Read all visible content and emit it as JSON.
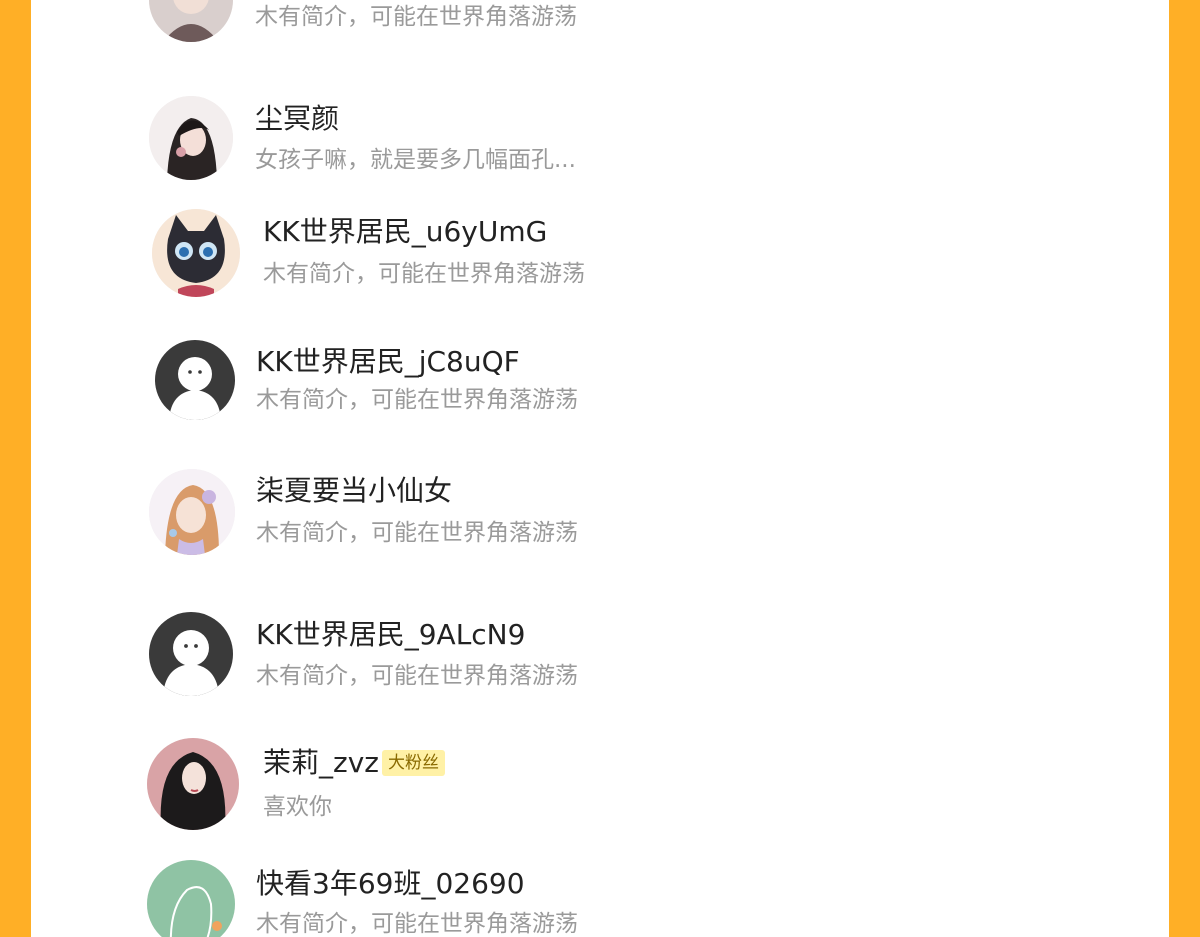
{
  "users": [
    {
      "name": "",
      "bio": "木有简介，可能在世界角落游荡",
      "avatar": "girl-portrait-avatar"
    },
    {
      "name": "尘冥颜",
      "bio": "女孩子嘛，就是要多几幅面孔...",
      "avatar": "girl-portrait-avatar"
    },
    {
      "name": "KK世界居民_u6yUmG",
      "bio": "木有简介，可能在世界角落游荡",
      "avatar": "black-cat-avatar"
    },
    {
      "name": "KK世界居民_jC8uQF",
      "bio": "木有简介，可能在世界角落游荡",
      "avatar": "default-ghost-avatar"
    },
    {
      "name": "柒夏要当小仙女",
      "bio": "木有简介，可能在世界角落游荡",
      "avatar": "anime-girl-avatar"
    },
    {
      "name": "KK世界居民_9ALcN9",
      "bio": "木有简介，可能在世界角落游荡",
      "avatar": "default-ghost-avatar"
    },
    {
      "name": "茉莉_zvz",
      "badge": "大粉丝",
      "bio": "喜欢你",
      "avatar": "dark-hair-girl-avatar"
    },
    {
      "name": "快看3年69班_02690",
      "bio": "木有简介，可能在世界角落游荡",
      "avatar": "green-silhouette-avatar"
    }
  ],
  "colors": {
    "frame_background": "#FFAF26",
    "badge_background": "#FFF1A6",
    "bio_text": "#9a9a9a"
  }
}
